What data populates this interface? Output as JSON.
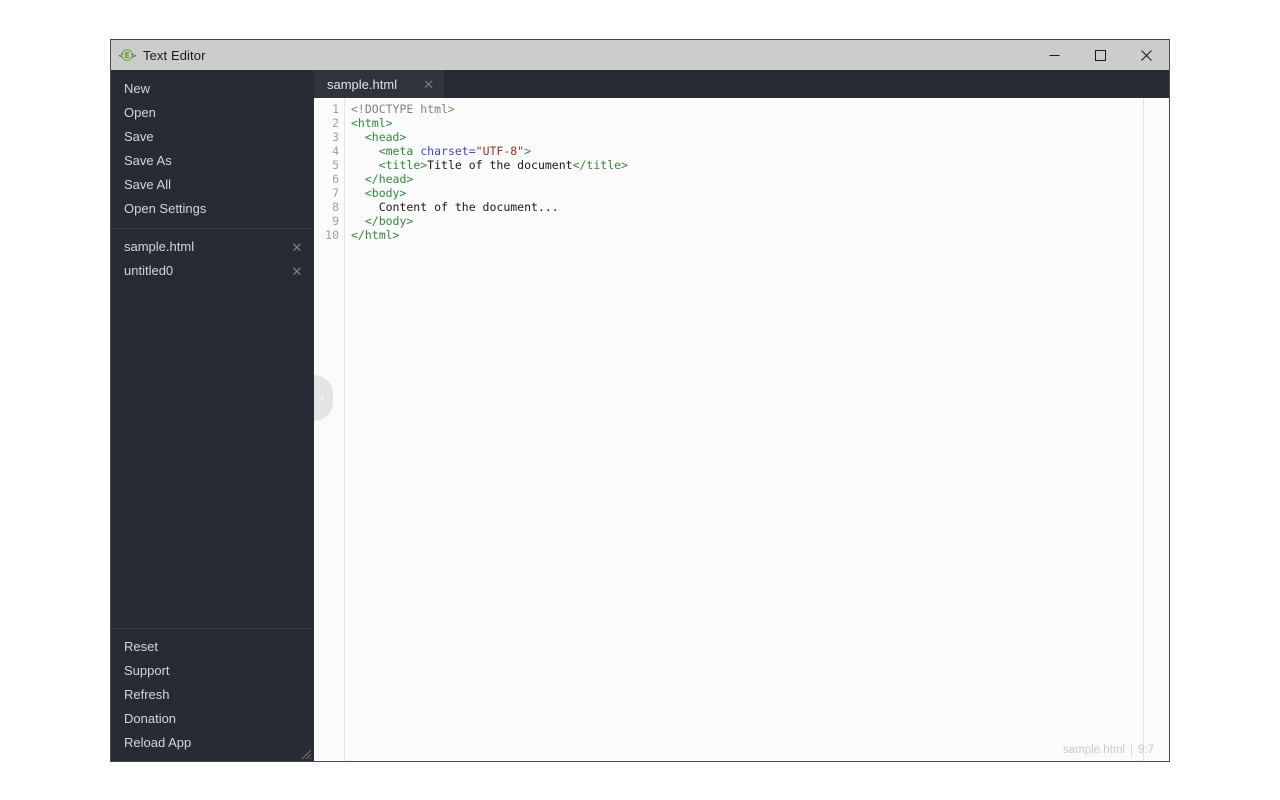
{
  "window": {
    "title": "Text Editor",
    "icon": "code-editor-icon",
    "controls": {
      "minimize": "—",
      "maximize": "□",
      "close": "✕"
    }
  },
  "sidebar": {
    "menu": [
      {
        "label": "New"
      },
      {
        "label": "Open"
      },
      {
        "label": "Save"
      },
      {
        "label": "Save As"
      },
      {
        "label": "Save All"
      },
      {
        "label": "Open Settings"
      }
    ],
    "files": [
      {
        "label": "sample.html",
        "close": "✕"
      },
      {
        "label": "untitled0",
        "close": "✕"
      }
    ],
    "bottom_menu": [
      {
        "label": "Reset"
      },
      {
        "label": "Support"
      },
      {
        "label": "Refresh"
      },
      {
        "label": "Donation"
      },
      {
        "label": "Reload App"
      }
    ]
  },
  "collapse_handle": {
    "chevron": "‹"
  },
  "tabs": [
    {
      "label": "sample.html",
      "close": "✕",
      "active": true
    }
  ],
  "editor": {
    "line_numbers": [
      "1",
      "2",
      "3",
      "4",
      "5",
      "6",
      "7",
      "8",
      "9",
      "10"
    ],
    "lines": [
      [
        {
          "t": "<!DOCTYPE html>",
          "c": "tk-doc"
        }
      ],
      [
        {
          "t": "<html>",
          "c": "tk-tag"
        }
      ],
      [
        {
          "t": "  ",
          "c": "tk-text"
        },
        {
          "t": "<head>",
          "c": "tk-tag"
        }
      ],
      [
        {
          "t": "    ",
          "c": "tk-text"
        },
        {
          "t": "<meta ",
          "c": "tk-tag"
        },
        {
          "t": "charset=",
          "c": "tk-attr"
        },
        {
          "t": "\"UTF-8\"",
          "c": "tk-val"
        },
        {
          "t": ">",
          "c": "tk-tag"
        }
      ],
      [
        {
          "t": "    ",
          "c": "tk-text"
        },
        {
          "t": "<title>",
          "c": "tk-tag"
        },
        {
          "t": "Title of the document",
          "c": "tk-text"
        },
        {
          "t": "</title>",
          "c": "tk-tag"
        }
      ],
      [
        {
          "t": "  ",
          "c": "tk-text"
        },
        {
          "t": "</head>",
          "c": "tk-tag"
        }
      ],
      [
        {
          "t": "  ",
          "c": "tk-text"
        },
        {
          "t": "<body>",
          "c": "tk-tag"
        }
      ],
      [
        {
          "t": "    Content of the document...",
          "c": "tk-text"
        }
      ],
      [
        {
          "t": "  ",
          "c": "tk-text"
        },
        {
          "t": "</body>",
          "c": "tk-tag"
        }
      ],
      [
        {
          "t": "</html>",
          "c": "tk-tag"
        }
      ]
    ]
  },
  "statusbar": {
    "filename": "sample.html",
    "cursor": "9:7"
  },
  "colors": {
    "sidebar_bg": "#272b33",
    "tabbar_bg": "#272b33",
    "tab_active_bg": "#2e333c",
    "titlebar_bg": "#cccccc",
    "editor_bg": "#fbfbfb",
    "tag": "#2d8a3e",
    "attr": "#3a49d6",
    "value": "#a03020",
    "doctype": "#808080"
  }
}
